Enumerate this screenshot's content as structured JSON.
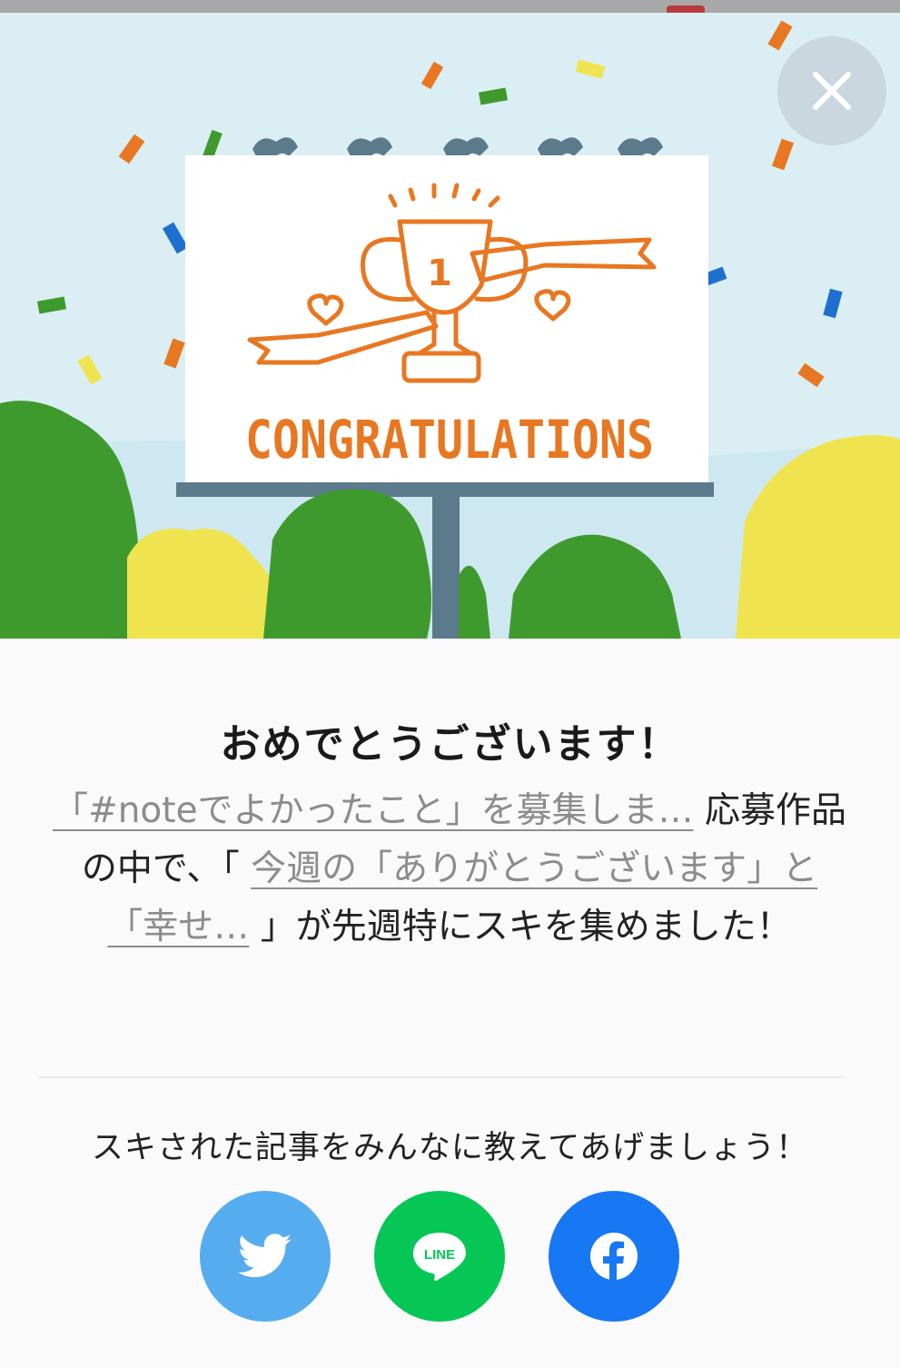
{
  "hero": {
    "banner_text": "CONGRATULATIONS",
    "trophy_number": "1",
    "colors": {
      "sky": "#dbeef3",
      "billboard": "#ffffff",
      "orange": "#e87722",
      "tree_green": "#3f9a2e",
      "tree_yellow": "#f0e350",
      "pole": "#5b7a8c"
    }
  },
  "close_button": {
    "icon": "close-icon"
  },
  "dialog": {
    "title": "おめでとうございます！",
    "contest_link": "「#noteでよかったこと」を募集しま…",
    "text_after_contest": " 応募作品の中で、「 ",
    "article_link": "今週の「ありがとうございます」と「幸せ…",
    "text_after_article": " 」が先週特にスキを集めました！"
  },
  "share": {
    "prompt": "スキされた記事をみんなに教えてあげましょう！",
    "buttons": [
      {
        "name": "twitter",
        "icon": "twitter-bird-icon",
        "color": "#55acee"
      },
      {
        "name": "line",
        "icon": "line-icon",
        "label": "LINE",
        "color": "#06c755"
      },
      {
        "name": "facebook",
        "icon": "facebook-icon",
        "color": "#1877f2"
      }
    ]
  }
}
